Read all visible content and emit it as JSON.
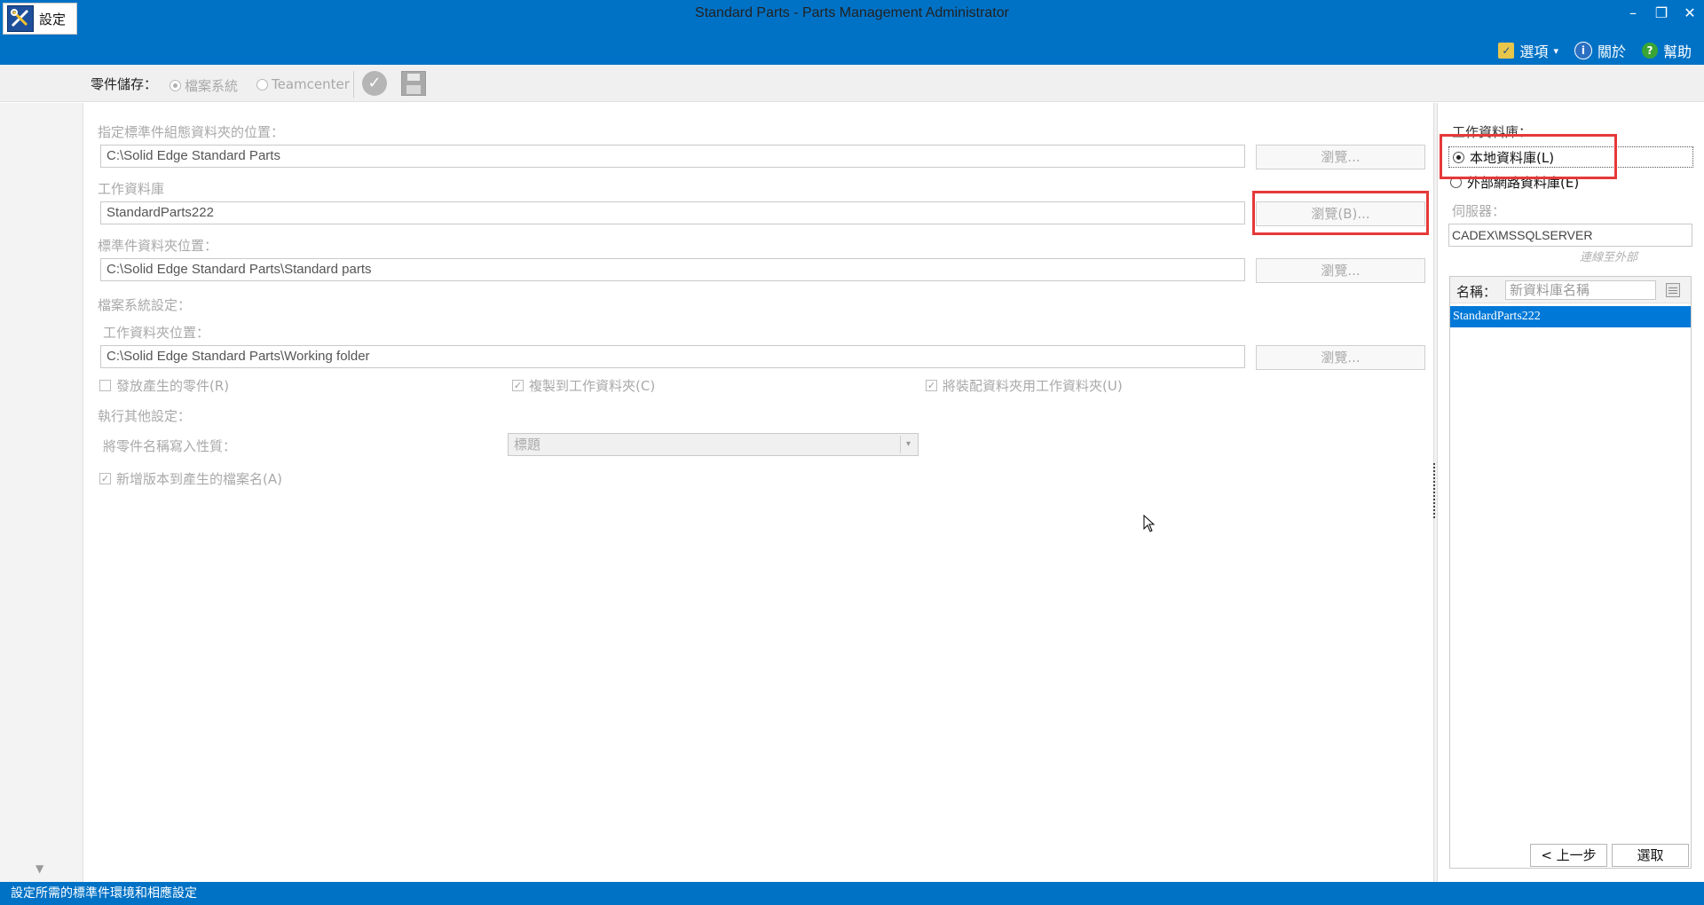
{
  "window": {
    "title": "Standard Parts - Parts Management Administrator",
    "minimize": "–",
    "restore": "❐",
    "close": "✕"
  },
  "menu": {
    "options": "選項",
    "options_arrow": "▾",
    "about": "關於",
    "help": "幫助"
  },
  "ribbon": {
    "settings_tab": "設定",
    "storage_label": "零件儲存：",
    "storage_options": [
      "檔案系統",
      "Teamcenter"
    ],
    "check_glyph": "✓"
  },
  "main": {
    "assembly_folder_label": "指定標準件組態資料夾的位置：",
    "assembly_folder_value": "C:\\Solid Edge Standard Parts",
    "browse1": "瀏覽...",
    "work_db_label": "工作資料庫",
    "work_db_value": "StandardParts222",
    "browse_b": "瀏覽(B)...",
    "std_folder_label": "標準件資料夾位置：",
    "std_folder_value": "C:\\Solid Edge Standard Parts\\Standard parts",
    "browse3": "瀏覽...",
    "fs_settings_label": "檔案系統設定：",
    "work_folder_label": "工作資料夾位置：",
    "work_folder_value": "C:\\Solid Edge Standard Parts\\Working folder",
    "browse4": "瀏覽...",
    "chk_release": "發放產生的零件(R)",
    "chk_copy": "複製到工作資料夾(C)",
    "chk_assembly": "將裝配資料夾用工作資料夾(U)",
    "other_settings_label": "執行其他設定：",
    "write_name_label": "將零件名稱寫入性質：",
    "write_name_value": "標題",
    "combo_arrow": "▾",
    "chk_version": "新增版本到產生的檔案名(A)",
    "check_mark": "✓"
  },
  "right": {
    "work_db_title": "工作資料庫：",
    "local_db": "本地資料庫(L)",
    "external_db": "外部網路資料庫(E)",
    "server_label": "伺服器：",
    "server_value": "CADEX\\MSSQLSERVER",
    "connect_external": "連線至外部",
    "name_label": "名稱：",
    "name_placeholder": "新資料庫名稱",
    "databases": [
      "StandardParts222"
    ],
    "prev_button": "< 上一步",
    "select_button": "選取"
  },
  "status": {
    "text": "設定所需的標準件環境和相應設定"
  }
}
